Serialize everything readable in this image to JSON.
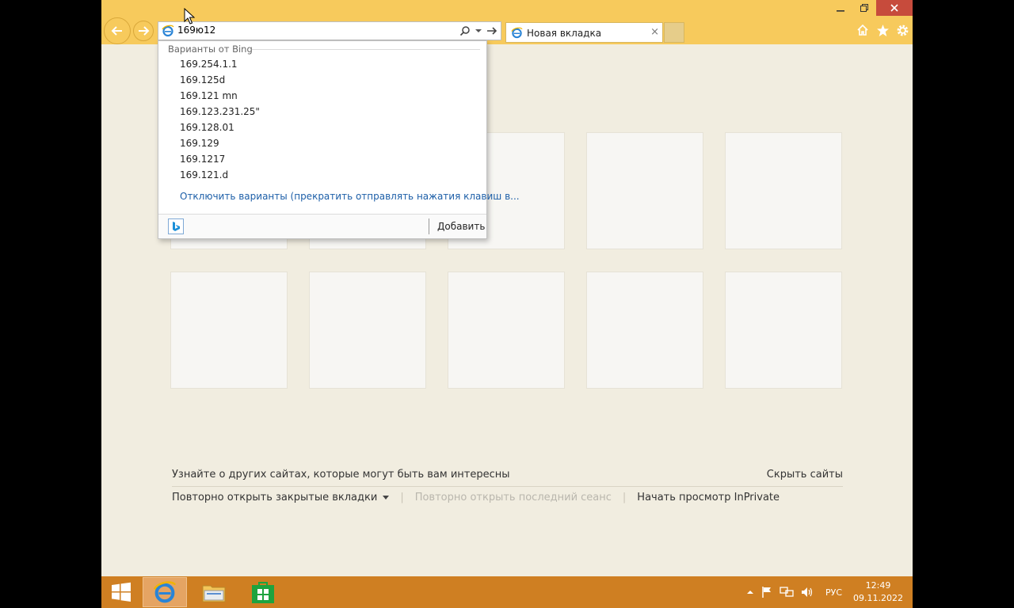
{
  "address": {
    "value": "169ю12"
  },
  "tab": {
    "title": "Новая вкладка",
    "close": "×"
  },
  "suggestions": {
    "header": "Варианты от Bing",
    "items": [
      "169.254.1.1",
      "169.125d",
      "169.121 mn",
      "169.123.231.25\"",
      "169.128.01",
      "169.129",
      "169.1217",
      "169.121.d"
    ],
    "turn_off": "Отключить варианты (прекратить отправлять нажатия клавиш в...",
    "add": "Добавить"
  },
  "tiles": {
    "rows": 2,
    "cols": 5
  },
  "footer": {
    "discover": "Узнайте о других сайтах, которые могут быть вам интересны",
    "hide_sites": "Скрыть сайты",
    "reopen_tabs": "Повторно открыть закрытые вкладки",
    "reopen_session": "Повторно открыть последний сеанс",
    "inprivate": "Начать просмотр InPrivate"
  },
  "taskbar": {
    "language": "РУС",
    "time": "12:49",
    "date": "09.11.2022"
  },
  "icons": {
    "back": "back-arrow-icon",
    "forward": "forward-arrow-icon",
    "home": "home-icon",
    "favorites": "star-icon",
    "settings": "gear-icon"
  },
  "colors": {
    "toolbar": "#f7ca5c",
    "page": "#f1ede0",
    "taskbar": "#cf7f22",
    "link": "#1d5fa8"
  }
}
